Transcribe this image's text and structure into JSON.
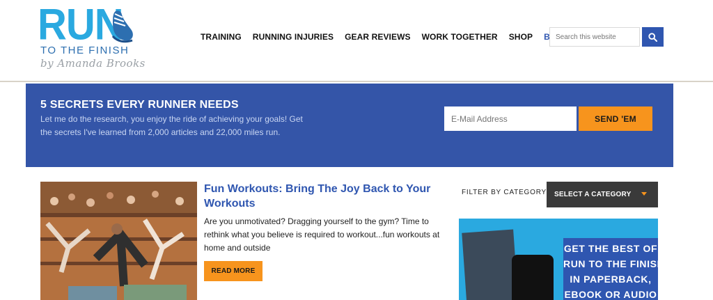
{
  "logo": {
    "run": "RUN",
    "subtitle": "TO THE FINISH",
    "byline": "by Amanda Brooks"
  },
  "nav": {
    "items": [
      "TRAINING",
      "RUNNING INJURIES",
      "GEAR REVIEWS",
      "WORK TOGETHER",
      "SHOP",
      "BLOG"
    ],
    "active": "BLOG"
  },
  "search": {
    "placeholder": "Search this website",
    "icon": "search-icon"
  },
  "banner": {
    "title": "5 SECRETS EVERY RUNNER NEEDS",
    "text": "Let me do the research, you enjoy the ride of achieving your goals! Get the secrets I've learned from 2,000 articles and 22,000 miles run.",
    "email_placeholder": "E-Mail Address",
    "button": "SEND 'EM"
  },
  "post": {
    "title": "Fun Workouts: Bring The Joy Back to Your Workouts",
    "excerpt": "Are you unmotivated? Dragging yourself to the gym? Time to rethink what you believe is required to workout...fun workouts at home and outside",
    "read_more": "READ MORE"
  },
  "sidebar": {
    "filter_label": "FILTER BY CATEGORY",
    "select_value": "SELECT A CATEGORY",
    "ad_lines": [
      "GET THE BEST OF",
      "RUN TO THE FINISH",
      "IN PAPERBACK,",
      "EBOOK OR AUDIO"
    ]
  },
  "colors": {
    "brand_blue": "#3455a8",
    "logo_cyan": "#2aa9e0",
    "accent_orange": "#f7941d"
  }
}
